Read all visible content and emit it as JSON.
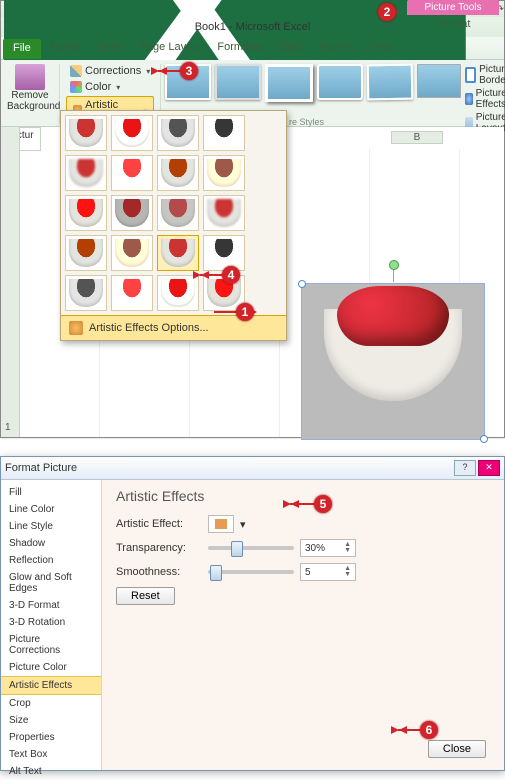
{
  "title": "Book1 - Microsoft Excel",
  "context_tab": {
    "group": "Picture Tools",
    "tab": "Format"
  },
  "tabs": [
    "File",
    "Home",
    "Insert",
    "Page Layout",
    "Formulas",
    "Data",
    "Review",
    "View"
  ],
  "adjust": {
    "remove_bg": "Remove Background",
    "corrections": "Corrections",
    "color": "Color",
    "artistic": "Artistic Effects"
  },
  "pic_right": {
    "border": "Picture Border",
    "effects": "Picture Effects",
    "layout": "Picture Layout"
  },
  "styles_label": "re Styles",
  "fx_options": "Artistic Effects Options...",
  "grid": {
    "colB": "B",
    "row1": "1",
    "namebox": "Pictur"
  },
  "dialog": {
    "title": "Format Picture",
    "categories": [
      "Fill",
      "Line Color",
      "Line Style",
      "Shadow",
      "Reflection",
      "Glow and Soft Edges",
      "3-D Format",
      "3-D Rotation",
      "Picture Corrections",
      "Picture Color",
      "Artistic Effects",
      "Crop",
      "Size",
      "Properties",
      "Text Box",
      "Alt Text"
    ],
    "selected": "Artistic Effects",
    "heading": "Artistic Effects",
    "effect_lbl": "Artistic Effect:",
    "transp_lbl": "Transparency:",
    "transp_val": "30%",
    "smooth_lbl": "Smoothness:",
    "smooth_val": "5",
    "reset": "Reset",
    "close": "Close"
  },
  "chart_data": {
    "type": "table",
    "description": "Format Picture > Artistic Effects parameters",
    "series": [
      {
        "name": "Transparency",
        "values": [
          30
        ],
        "unit": "%",
        "range": [
          0,
          100
        ]
      },
      {
        "name": "Smoothness",
        "values": [
          5
        ],
        "unit": "",
        "range": [
          0,
          100
        ]
      }
    ]
  }
}
